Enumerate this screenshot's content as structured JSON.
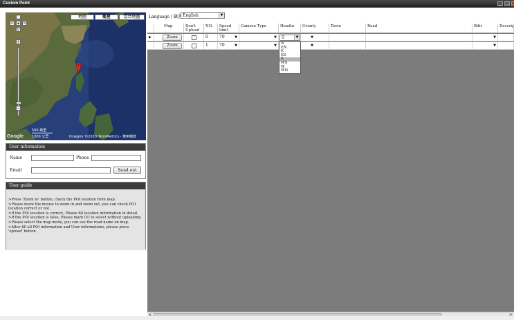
{
  "window": {
    "title": "Custom Point",
    "controls": [
      "_",
      "□",
      "x"
    ]
  },
  "map": {
    "types": [
      "地圖",
      "衛星",
      "混合地圖"
    ],
    "pan_up": "^",
    "pan_left": "<",
    "pan_right": ">",
    "pan_down": "v",
    "zoom_in": "+",
    "zoom_out": "−",
    "scale_top": "500 英里",
    "scale_bottom": "1000 公里",
    "logo": "Google",
    "copyright": "Imagery ©2010 TerraMetrics - 使用條款"
  },
  "user_info": {
    "header": "User information",
    "name_label": "Name",
    "phone_label": "Phone",
    "email_label": "Email",
    "name_value": "",
    "phone_value": "",
    "email_value": "",
    "send_button": "Send out"
  },
  "user_guide": {
    "header": "User guide",
    "lines": [
      ">Press 'Zoom to' button, check the POI location from map.",
      ">Please move the mouse to zoom in and zoom out, you can check POI location correct or not.",
      ">If the POI location is correct, Please fill location information in detail.",
      ">If the POI location is false, Please mark (V) to select without uploading.",
      ">Please select the map mode, you can see the road name on map.",
      ">After fill all POI information and User informations, please press 'upload' button."
    ]
  },
  "language": {
    "label": "Language / 語言",
    "selected": "English"
  },
  "grid": {
    "columns": [
      "Map",
      "Don't Upload",
      "NO.",
      "Speed limit",
      "Camera Type",
      "Headin",
      "County",
      "Town",
      "Road",
      "Bdir",
      "Descript"
    ],
    "rows": [
      {
        "zoom": "Zoom",
        "no": "0",
        "speed": "70",
        "camera": "",
        "heading": "S",
        "county": "",
        "town": "",
        "road": "",
        "bdir": ""
      },
      {
        "zoom": "Zoom",
        "no": "1",
        "speed": "70",
        "camera": "",
        "heading": "",
        "county": "",
        "town": "",
        "road": "",
        "bdir": ""
      }
    ],
    "row_indicator": "▶",
    "heading_options": [
      "N",
      "EN",
      "E",
      "ES",
      "S",
      "WS",
      "W",
      "WN"
    ],
    "heading_highlighted": "S"
  },
  "colors": {
    "titlebar": "#2a2a2a",
    "panel_header": "#3c3c3c",
    "grid_background": "#7c7c7c",
    "map_marker": "#d9302c"
  }
}
